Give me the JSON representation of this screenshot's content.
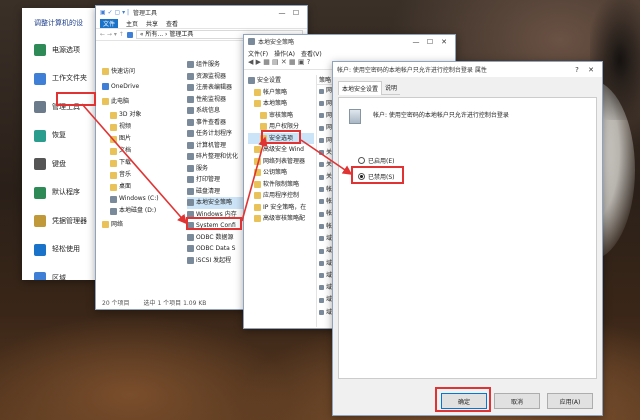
{
  "control_panel": {
    "title": "调整计算机的设",
    "items": [
      "电源选项",
      "工作文件夹",
      "管理工具",
      "恢复",
      "键盘",
      "默认程序",
      "凭据管理器",
      "轻松使用",
      "区域"
    ]
  },
  "explorer": {
    "title": "管理工具",
    "tabs": [
      "文件",
      "主页",
      "共享",
      "查看"
    ],
    "address": "« 所有... › 管理工具",
    "nav": [
      "快速访问",
      "OneDrive",
      "此电脑",
      "3D 对象",
      "视频",
      "图片",
      "文档",
      "下载",
      "音乐",
      "桌面",
      "Windows (C:)",
      "本地磁盘 (D:)",
      "网络"
    ],
    "files": [
      "组件服务",
      "资源监视器",
      "注册表编辑器",
      "性能监视器",
      "系统信息",
      "事件查看器",
      "任务计划程序",
      "计算机管理",
      "碎片整理和优化",
      "服务",
      "打印管理",
      "磁盘清理",
      "本地安全策略",
      "Windows 内存",
      "System Confi",
      "ODBC 数据源",
      "ODBC Data S",
      "iSCSI 发起程"
    ],
    "status": "20 个项目",
    "status2": "选中 1 个项目  1.09 KB"
  },
  "secpol": {
    "title": "本地安全策略",
    "menu": [
      "文件(F)",
      "操作(A)",
      "查看(V)"
    ],
    "tree": [
      "安全设置",
      "帐户策略",
      "本地策略",
      "审核策略",
      "用户权限分",
      "安全选项",
      "高级安全 Wind",
      "网络列表管理器",
      "公钥策略",
      "软件限制策略",
      "应用程序控制",
      "IP 安全策略，在",
      "高级审核策略配"
    ],
    "col": "策略",
    "rows": [
      "网",
      "网",
      "网",
      "网",
      "网",
      "关",
      "关",
      "关",
      "帐",
      "帐",
      "帐",
      "帐",
      "域",
      "域",
      "域",
      "域",
      "域",
      "域",
      "域"
    ]
  },
  "dialog": {
    "title": "帐户: 使用空密码的本地帐户只允许进行控制台登录 属性",
    "tabs": [
      "本地安全设置",
      "说明"
    ],
    "policy": "帐户: 使用空密码的本地帐户只允许进行控制台登录",
    "options": [
      "已启用(E)",
      "已禁用(S)"
    ],
    "selected": 1,
    "ok": "确定",
    "cancel": "取消",
    "apply": "应用(A)",
    "help": "?"
  },
  "colors": {
    "accent": "#1a73c8",
    "highlight": "#e03434",
    "selection": "#cce4f7"
  }
}
